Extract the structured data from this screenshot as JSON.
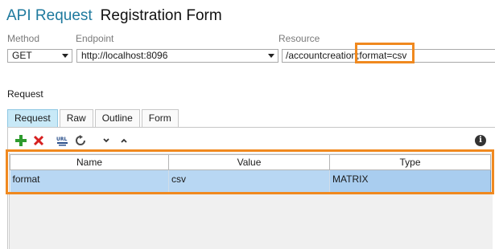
{
  "header": {
    "prefix": "API Request",
    "title": "Registration Form"
  },
  "fields": {
    "method": {
      "label": "Method",
      "value": "GET"
    },
    "endpoint": {
      "label": "Endpoint",
      "value": "http://localhost:8096"
    },
    "resource": {
      "label": "Resource",
      "path": "/accountcreation",
      "matrix_part": ";format=csv"
    }
  },
  "request": {
    "section_label": "Request",
    "tabs": [
      {
        "label": "Request",
        "active": true
      },
      {
        "label": "Raw",
        "active": false
      },
      {
        "label": "Outline",
        "active": false
      },
      {
        "label": "Form",
        "active": false
      }
    ],
    "toolbar_icons": [
      "add-icon",
      "delete-icon",
      "url-encode-icon",
      "refresh-icon",
      "move-down-icon",
      "move-up-icon",
      "info-icon"
    ],
    "table": {
      "columns": [
        "Name",
        "Value",
        "Type"
      ],
      "rows": [
        {
          "name": "format",
          "value": "csv",
          "type": "MATRIX",
          "selected": true
        }
      ]
    }
  },
  "colors": {
    "accent": "#1f7a9e",
    "highlight": "#f0891f",
    "selected_row": "#b8d7f3",
    "active_tab": "#c8e9f7"
  }
}
